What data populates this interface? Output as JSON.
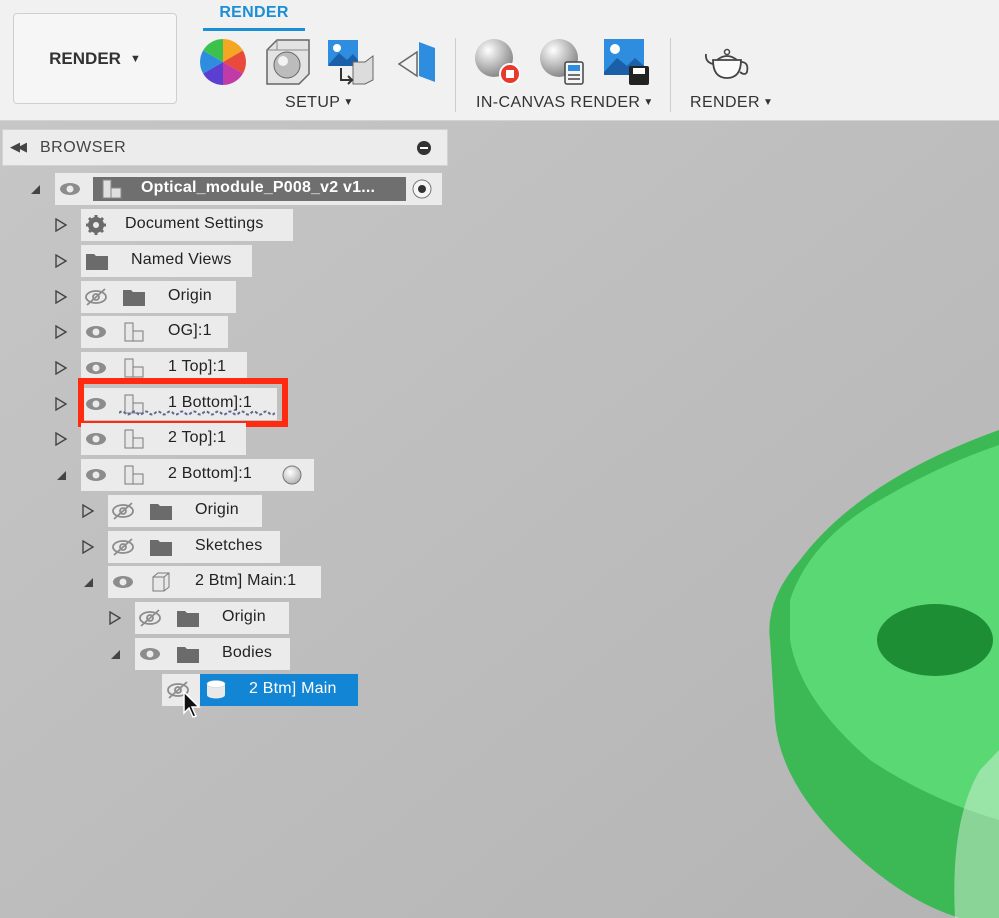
{
  "toolbar": {
    "workspace_label": "RENDER",
    "active_tab": "RENDER",
    "groups": [
      {
        "label": "SETUP"
      },
      {
        "label": "IN-CANVAS RENDER"
      },
      {
        "label": "RENDER"
      }
    ],
    "icons": [
      "color-wheel-icon",
      "scene-settings-icon",
      "texture-map-icon",
      "decal-icon",
      "in-canvas-render-stop-icon",
      "in-canvas-render-settings-icon",
      "capture-image-icon",
      "render-teapot-icon"
    ]
  },
  "browser": {
    "title": "BROWSER",
    "root": {
      "label": "Optical_module_P008_v2 v1..."
    },
    "items": [
      {
        "label": "Document Settings"
      },
      {
        "label": "Named Views"
      },
      {
        "label": "Origin"
      },
      {
        "label": "OG]:1"
      },
      {
        "label": "1 Top]:1"
      },
      {
        "label": "1 Bottom]:1"
      },
      {
        "label": "2 Top]:1"
      },
      {
        "label": "2 Bottom]:1"
      },
      {
        "label": "Origin"
      },
      {
        "label": "Sketches"
      },
      {
        "label": "2 Btm] Main:1"
      },
      {
        "label": "Origin"
      },
      {
        "label": "Bodies"
      },
      {
        "label": "2 Btm] Main"
      }
    ]
  },
  "colors": {
    "accent": "#1b8fd6",
    "selection": "#1285d4",
    "highlight": "#ff2a10",
    "model_green": "#4fd86a",
    "canvas_gray": "#bdbdbd"
  }
}
